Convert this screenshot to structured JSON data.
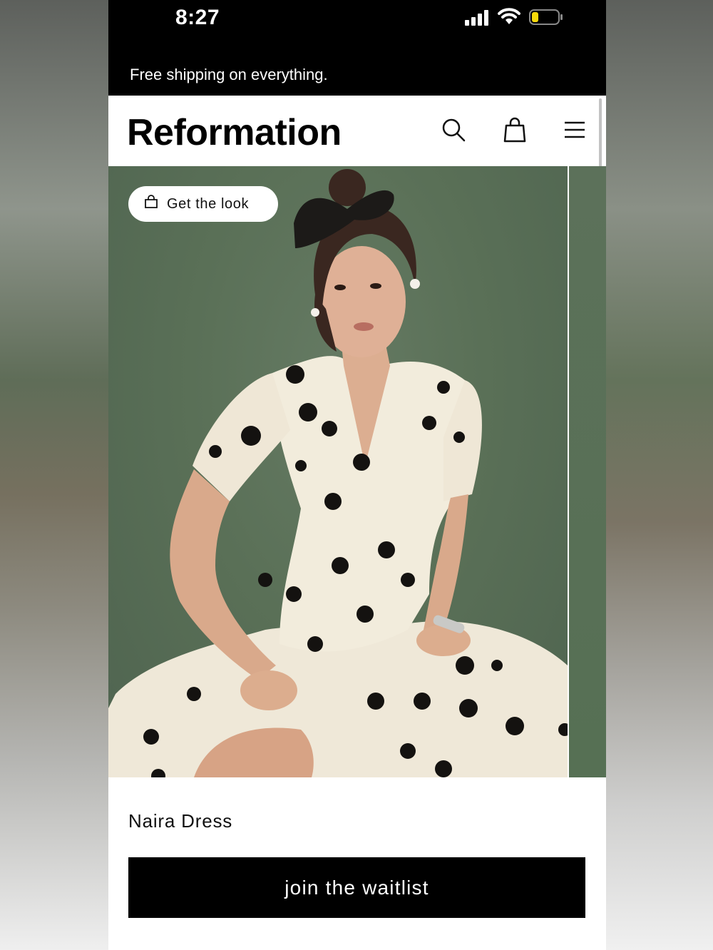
{
  "status_bar": {
    "time": "8:27",
    "signal_icon": "signal-bars-icon",
    "wifi_icon": "wifi-icon",
    "battery_icon": "battery-low-icon",
    "battery_color": "#f5d90a"
  },
  "promo_banner": {
    "text": "Free shipping on everything."
  },
  "header": {
    "brand": "Reformation",
    "icons": [
      "search-icon",
      "shopping-bag-icon",
      "hamburger-menu-icon"
    ]
  },
  "hero": {
    "image": "model-in-polka-dot-dress",
    "background_color": "#5a7057",
    "get_the_look_label": "Get the look",
    "get_the_look_icon": "shopping-bag-icon"
  },
  "product": {
    "name": "Naira Dress",
    "cta_label": "join the waitlist"
  },
  "colors": {
    "brand_black": "#000000",
    "white": "#ffffff"
  }
}
